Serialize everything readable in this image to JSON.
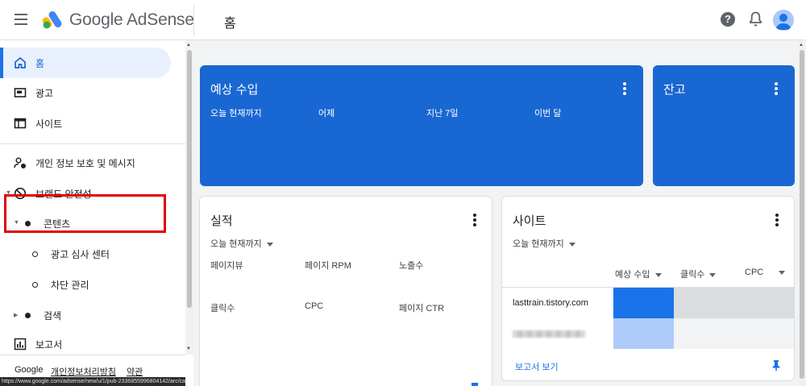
{
  "header": {
    "brand": "Google AdSense",
    "page_title": "홈",
    "help_symbol": "?"
  },
  "sidebar": {
    "home": "홈",
    "ads": "광고",
    "sites": "사이트",
    "privacy": "개인 정보 보호 및 메시지",
    "brand_safety": "브랜드 안전성",
    "content": "콘텐츠",
    "ad_review": "광고 심사 센터",
    "blocking": "차단 관리",
    "search": "검색",
    "reports": "보고서",
    "footer": {
      "google": "Google",
      "privacy_policy": "개인정보처리방침",
      "terms": "약관"
    },
    "status_url": "https://www.google.com/adsense/new/u/1/pub-2336855996804142/arc/ca-pub-"
  },
  "earnings_card": {
    "title": "예상 수입",
    "columns": [
      "오늘 현재까지",
      "어제",
      "지난 7일",
      "이번 달"
    ]
  },
  "balance_card": {
    "title": "잔고"
  },
  "performance_card": {
    "title": "실적",
    "range": "오늘 현재까지",
    "metrics": [
      "페이지뷰",
      "페이지 RPM",
      "노출수",
      "클릭수",
      "CPC",
      "페이지 CTR"
    ]
  },
  "sites_card": {
    "title": "사이트",
    "range": "오늘 현재까지",
    "columns": [
      "예상 수입",
      "클릭수",
      "CPC"
    ],
    "rows": [
      {
        "domain": "lasttrain.tistory.com"
      }
    ],
    "view_report": "보고서 보기"
  },
  "colors": {
    "accent": "#1967d2",
    "active_nav_bg": "#e8f0fe",
    "highlight": "#e00000"
  }
}
